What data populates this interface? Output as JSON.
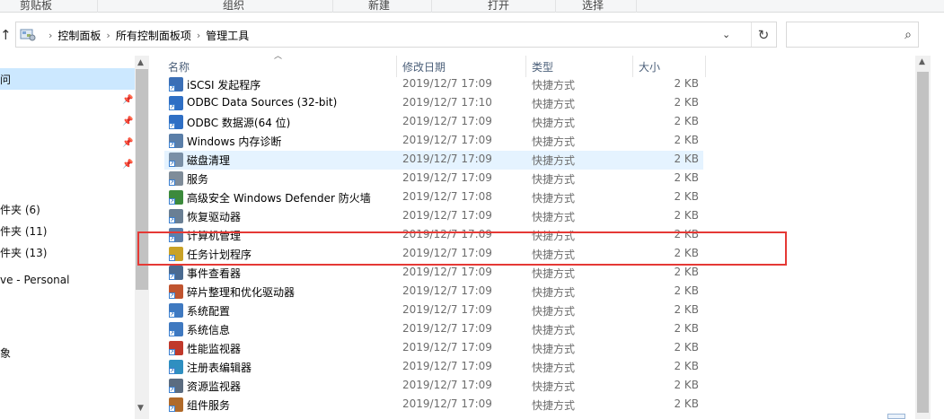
{
  "ribbon": {
    "groups": [
      "剪贴板",
      "组织",
      "新建",
      "打开",
      "选择"
    ]
  },
  "address": {
    "crumbs": [
      "控制面板",
      "所有控制面板项",
      "管理工具"
    ],
    "search_placeholder": ""
  },
  "nav": {
    "items": [
      "问",
      "件夹 (6)",
      "件夹 (11)",
      "件夹 (13)",
      "ve - Personal",
      "象"
    ]
  },
  "columns": {
    "name": "名称",
    "date": "修改日期",
    "type": "类型",
    "size": "大小"
  },
  "files": [
    {
      "name": "iSCSI 发起程序",
      "date": "2019/12/7 17:09",
      "type": "快捷方式",
      "size": "2 KB",
      "icon": "iscsi-icon",
      "color": "#3b6fb6"
    },
    {
      "name": "ODBC Data Sources (32-bit)",
      "date": "2019/12/7 17:10",
      "type": "快捷方式",
      "size": "2 KB",
      "icon": "odbc-icon",
      "color": "#2f6fc4"
    },
    {
      "name": "ODBC 数据源(64 位)",
      "date": "2019/12/7 17:09",
      "type": "快捷方式",
      "size": "2 KB",
      "icon": "odbc-icon",
      "color": "#2f6fc4"
    },
    {
      "name": "Windows 内存诊断",
      "date": "2019/12/7 17:09",
      "type": "快捷方式",
      "size": "2 KB",
      "icon": "memory-diagnostic-icon",
      "color": "#5a7ea8"
    },
    {
      "name": "磁盘清理",
      "date": "2019/12/7 17:09",
      "type": "快捷方式",
      "size": "2 KB",
      "icon": "disk-cleanup-icon",
      "color": "#7a8fa6"
    },
    {
      "name": "服务",
      "date": "2019/12/7 17:09",
      "type": "快捷方式",
      "size": "2 KB",
      "icon": "services-icon",
      "color": "#7f8c99"
    },
    {
      "name": "高级安全 Windows Defender 防火墙",
      "date": "2019/12/7 17:08",
      "type": "快捷方式",
      "size": "2 KB",
      "icon": "firewall-icon",
      "color": "#3c8a3c"
    },
    {
      "name": "恢复驱动器",
      "date": "2019/12/7 17:09",
      "type": "快捷方式",
      "size": "2 KB",
      "icon": "recovery-drive-icon",
      "color": "#6a7f94"
    },
    {
      "name": "计算机管理",
      "date": "2019/12/7 17:09",
      "type": "快捷方式",
      "size": "2 KB",
      "icon": "computer-management-icon",
      "color": "#5d7fa8"
    },
    {
      "name": "任务计划程序",
      "date": "2019/12/7 17:09",
      "type": "快捷方式",
      "size": "2 KB",
      "icon": "task-scheduler-icon",
      "color": "#c9a227"
    },
    {
      "name": "事件查看器",
      "date": "2019/12/7 17:09",
      "type": "快捷方式",
      "size": "2 KB",
      "icon": "event-viewer-icon",
      "color": "#4a6a90"
    },
    {
      "name": "碎片整理和优化驱动器",
      "date": "2019/12/7 17:09",
      "type": "快捷方式",
      "size": "2 KB",
      "icon": "defrag-icon",
      "color": "#c0542f"
    },
    {
      "name": "系统配置",
      "date": "2019/12/7 17:09",
      "type": "快捷方式",
      "size": "2 KB",
      "icon": "system-config-icon",
      "color": "#3f79c0"
    },
    {
      "name": "系统信息",
      "date": "2019/12/7 17:09",
      "type": "快捷方式",
      "size": "2 KB",
      "icon": "system-info-icon",
      "color": "#3f79c0"
    },
    {
      "name": "性能监视器",
      "date": "2019/12/7 17:09",
      "type": "快捷方式",
      "size": "2 KB",
      "icon": "performance-monitor-icon",
      "color": "#c0392b"
    },
    {
      "name": "注册表编辑器",
      "date": "2019/12/7 17:09",
      "type": "快捷方式",
      "size": "2 KB",
      "icon": "registry-editor-icon",
      "color": "#2f8fc0"
    },
    {
      "name": "资源监视器",
      "date": "2019/12/7 17:09",
      "type": "快捷方式",
      "size": "2 KB",
      "icon": "resource-monitor-icon",
      "color": "#5b6c80"
    },
    {
      "name": "组件服务",
      "date": "2019/12/7 17:09",
      "type": "快捷方式",
      "size": "2 KB",
      "icon": "component-services-icon",
      "color": "#b06a2a"
    }
  ],
  "hovered_row": 4,
  "highlight_color": "#e53935",
  "selection_color": "#cce8ff"
}
